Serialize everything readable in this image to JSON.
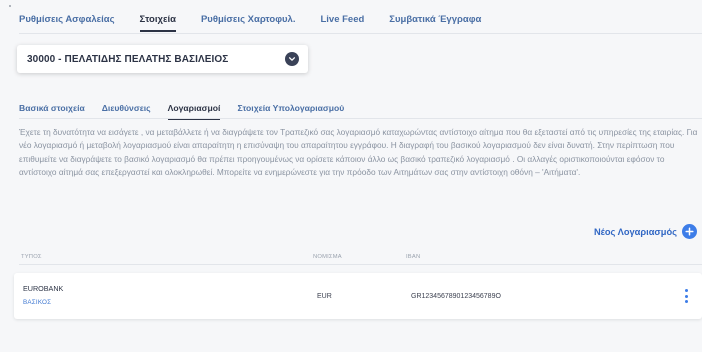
{
  "top_tabs": [
    {
      "label": "Ρυθμίσεις Ασφαλείας"
    },
    {
      "label": "Στοιχεία"
    },
    {
      "label": "Ρυθμίσεις Χαρτοφυλ."
    },
    {
      "label": "Live Feed"
    },
    {
      "label": "Συμβατικά Έγγραφα"
    }
  ],
  "customer_select": {
    "value": "30000 - ΠΕΛΑΤΙΔΗΣ ΠΕΛΑΤΗΣ ΒΑΣΙΛΕΙΟΣ"
  },
  "sub_tabs": [
    {
      "label": "Βασικά στοιχεία"
    },
    {
      "label": "Διευθύνσεις"
    },
    {
      "label": "Λογαριασμοί"
    },
    {
      "label": "Στοιχεία Υπολογαριασμού"
    }
  ],
  "info_text": "Έχετε τη δυνατότητα να εισάγετε , να μεταβάλλετε ή να διαγράψετε τον Τραπεζικό σας λογαριασμό καταχωρώντας αντίστοιχο αίτημα που θα εξεταστεί από τις υπηρεσίες της εταιρίας. Για νέο λογαριασμό ή μεταβολή λογαριασμού είναι απαραίτητη η επισύναψη του απαραίτητου εγγράφου. Η διαγραφή του βασικού λογαριασμού δεν είναι δυνατή. Στην περίπτωση που επιθυμείτε να διαγράψετε το βασικό λογαριασμό θα πρέπει προηγουμένως να ορίσετε κάποιον άλλο ως βασικό τραπεζικό λογαριασμό . Οι αλλαγές οριστικοποιούνται εφόσον το αντίστοιχο αίτημά σας επεξεργαστεί και ολοκληρωθεί. Μπορείτε να ενημερώνεστε για την πρόοδο των Αιτημάτων σας στην αντίστοιχη οθόνη – 'Αιτήματα'.",
  "new_account_label": "Νέος Λογαριασμός",
  "table": {
    "headers": {
      "type": "ΤΥΠΟΣ",
      "currency": "ΝΟΜΙΣΜΑ",
      "iban": "IBAN"
    },
    "rows": [
      {
        "bank": "EUROBANK",
        "account_type": "ΒΑΣΙΚΟΣ",
        "currency": "EUR",
        "iban": "GR1234567890123456789O"
      }
    ]
  },
  "colors": {
    "accent": "#3d7de8",
    "link": "#4a6fa5",
    "text_dark": "#2c3345",
    "muted_text": "#8a93a1"
  },
  "icons": {
    "customer_select": "chevron-down-icon",
    "new_account": "plus-icon",
    "row_menu": "more-vertical-icon"
  }
}
